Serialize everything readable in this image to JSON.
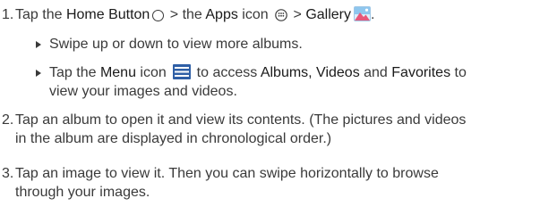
{
  "steps": [
    {
      "number": "1.",
      "parts": {
        "t1": "Tap the ",
        "home_button": "Home Button",
        "t2": " > the ",
        "apps": "Apps",
        "t3": " icon ",
        "t4": " > ",
        "gallery": "Gallery",
        "t5": "."
      },
      "bullets": [
        {
          "text": "Swipe up or down to view more albums."
        },
        {
          "t1": "Tap the ",
          "menu": "Menu",
          "t2": " icon ",
          "t3": " to access ",
          "albums": "Albums, Videos",
          "t4": " and ",
          "favorites": "Favorites",
          "t5": " to",
          "line2": "view your images and videos."
        }
      ]
    },
    {
      "number": "2.",
      "line1": "Tap an album to open it and view its contents. (The pictures and videos",
      "line2": "in the album are displayed in chronological order.)"
    },
    {
      "number": "3.",
      "line1": "Tap an image to view it. Then you can swipe horizontally to browse",
      "line2": "through your images."
    }
  ],
  "icons": {
    "home": "home-circle-icon",
    "apps": "apps-grid-icon",
    "gallery": "gallery-picture-icon",
    "menu": "menu-hamburger-icon"
  },
  "colors": {
    "text": "#3a3a3a",
    "menu_icon": "#2f5fa6",
    "gallery_sky": "#4a9fd9",
    "gallery_mountain": "#e8577a"
  }
}
